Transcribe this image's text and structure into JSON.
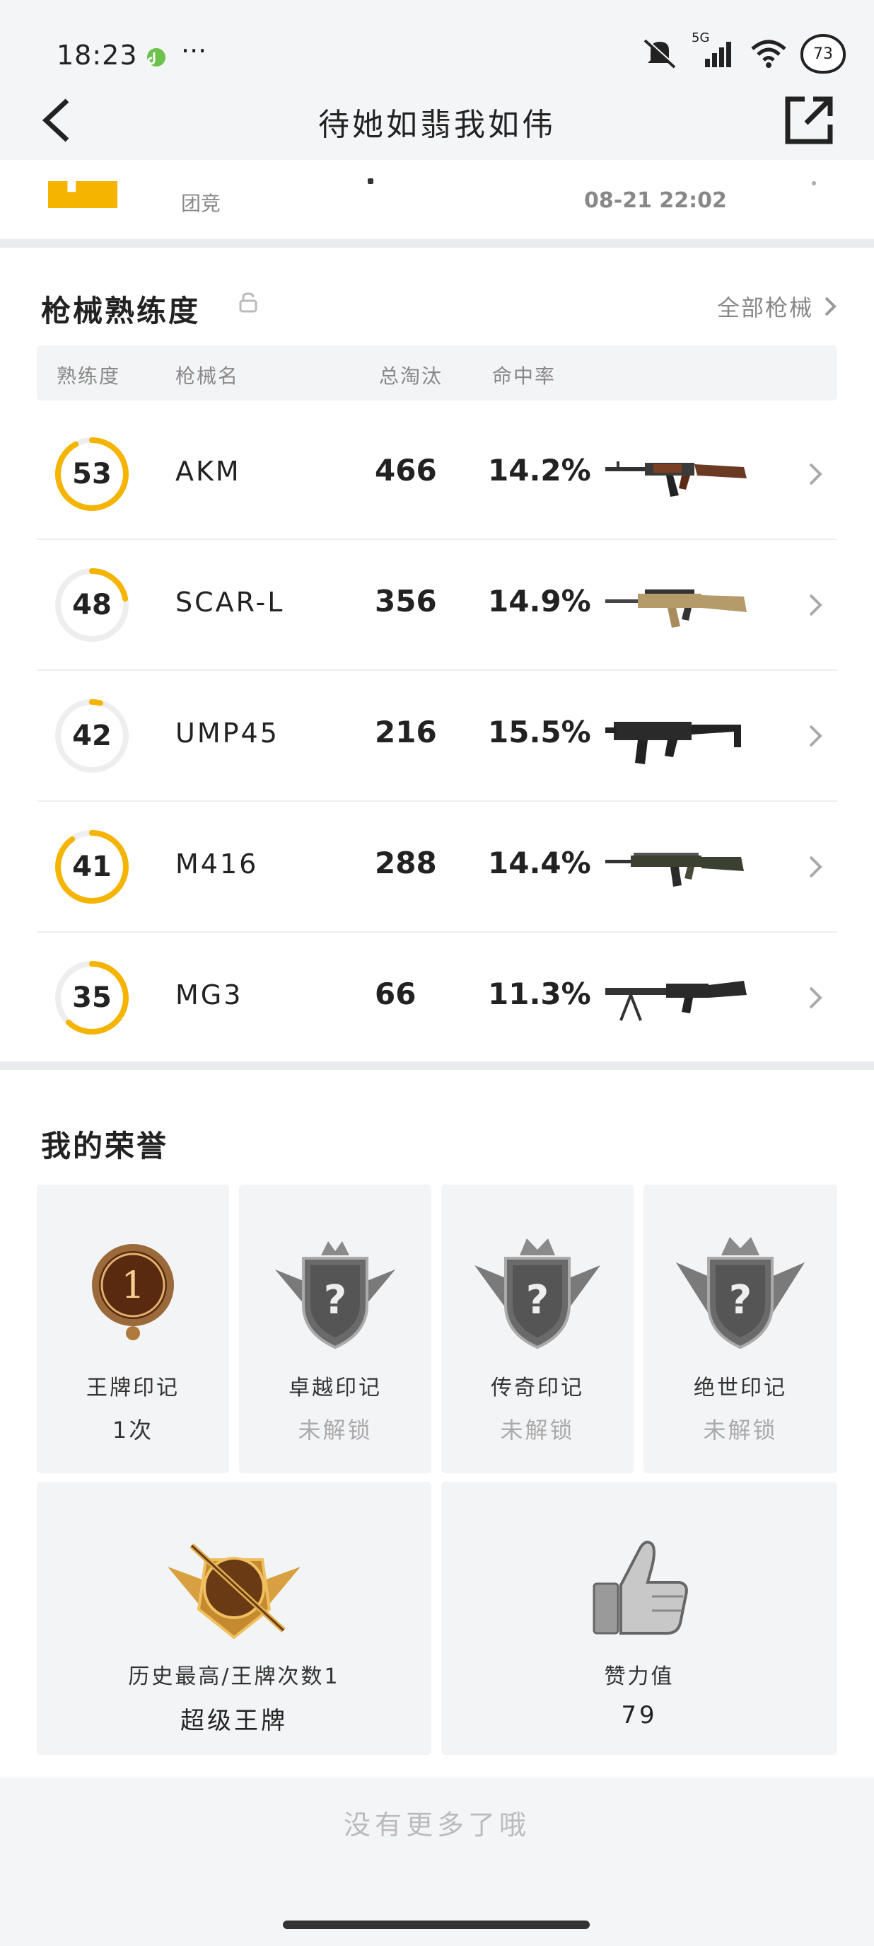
{
  "status_bar": {
    "time": "18:23",
    "dots": "···",
    "network": "5G",
    "battery": "73"
  },
  "header": {
    "title": "待她如翡我如伟"
  },
  "record_peek": {
    "mode": "团竞",
    "time": "08-21 22:02"
  },
  "weapons": {
    "title": "枪械熟练度",
    "all_link": "全部枪械",
    "columns": {
      "level": "熟练度",
      "name": "枪械名",
      "kills": "总淘汰",
      "hitrate": "命中率"
    },
    "rows": [
      {
        "level": "53",
        "progress": 0.92,
        "name": "AKM",
        "kills": "466",
        "hitrate": "14.2%",
        "icon": "akm-rifle-icon"
      },
      {
        "level": "48",
        "progress": 0.22,
        "name": "SCAR-L",
        "kills": "356",
        "hitrate": "14.9%",
        "icon": "scar-l-rifle-icon"
      },
      {
        "level": "42",
        "progress": 0.04,
        "name": "UMP45",
        "kills": "216",
        "hitrate": "15.5%",
        "icon": "ump45-smg-icon"
      },
      {
        "level": "41",
        "progress": 0.9,
        "name": "M416",
        "kills": "288",
        "hitrate": "14.4%",
        "icon": "m416-rifle-icon"
      },
      {
        "level": "35",
        "progress": 0.62,
        "name": "MG3",
        "kills": "66",
        "hitrate": "11.3%",
        "icon": "mg3-machine-gun-icon"
      }
    ]
  },
  "honors": {
    "title": "我的荣誉",
    "cards": [
      {
        "label": "王牌印记",
        "value": "1次",
        "locked": false,
        "icon": "ace-mark-emblem-icon"
      },
      {
        "label": "卓越印记",
        "value": "未解锁",
        "locked": true,
        "icon": "excellence-mark-emblem-icon"
      },
      {
        "label": "传奇印记",
        "value": "未解锁",
        "locked": true,
        "icon": "legend-mark-emblem-icon"
      },
      {
        "label": "绝世印记",
        "value": "未解锁",
        "locked": true,
        "icon": "peerless-mark-emblem-icon"
      }
    ],
    "highest": {
      "label": "历史最高/王牌次数1",
      "value": "超级王牌",
      "icon": "super-ace-badge-icon"
    },
    "likes": {
      "label": "赞力值",
      "value": "79",
      "icon": "thumbs-up-icon"
    }
  },
  "footer": {
    "no_more": "没有更多了哦"
  },
  "colors": {
    "accent": "#f5b400",
    "ring_track": "#eeeeee",
    "muted": "#888888"
  }
}
